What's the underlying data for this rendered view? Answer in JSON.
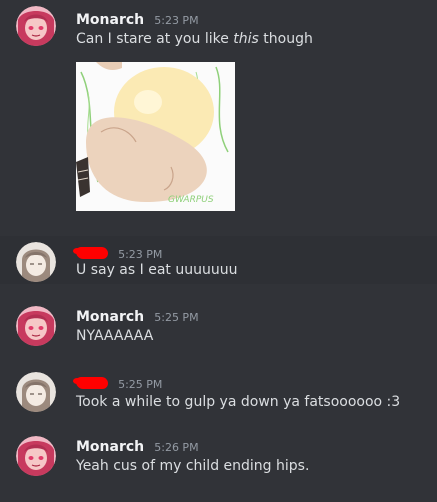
{
  "messages": [
    {
      "author": "Monarch",
      "timestamp": "5:23 PM",
      "text_before": "Can I stare at you like ",
      "text_emphasis": "this",
      "text_after": " though",
      "attachment": {
        "type": "image",
        "watermark": "GWARPUS"
      }
    },
    {
      "author": "",
      "author_redacted": true,
      "timestamp": "5:23 PM",
      "text": "U say as I eat uuuuuuu"
    },
    {
      "author": "Monarch",
      "timestamp": "5:25 PM",
      "text": "NYAAAAAA"
    },
    {
      "author": "",
      "author_redacted": true,
      "timestamp": "5:25 PM",
      "text": "Took a while to gulp ya down ya fatsoooooo :3"
    },
    {
      "author": "Monarch",
      "timestamp": "5:26 PM",
      "text": "Yeah cus of my child ending hips."
    }
  ],
  "colors": {
    "background": "#313338",
    "hover_background": "#2e3035",
    "username": "#f2f3f5",
    "timestamp": "#949ba4",
    "message_text": "#dbdee1",
    "redaction": "#ff0000"
  }
}
